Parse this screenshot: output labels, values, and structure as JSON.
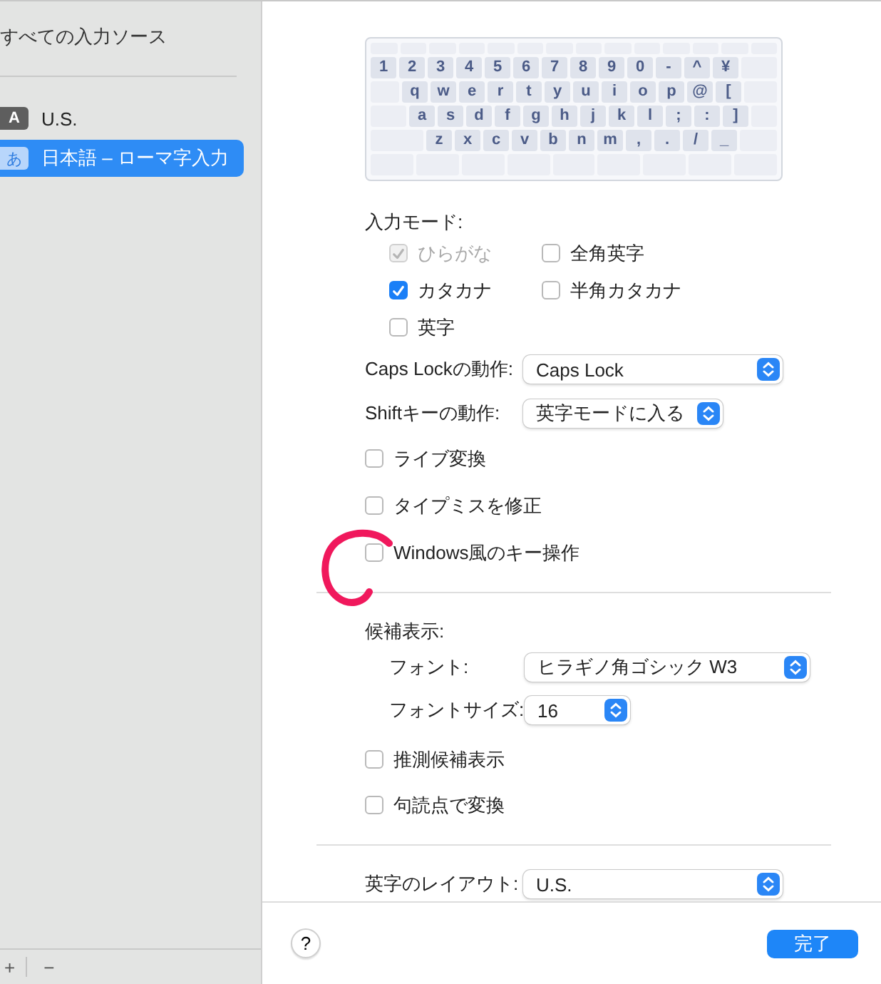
{
  "sidebar": {
    "header": "すべての入力ソース",
    "items": [
      {
        "badge": "A",
        "label": "U.S.",
        "selected": false
      },
      {
        "badge": "あ",
        "label": "日本語 – ローマ字入力",
        "selected": true
      }
    ],
    "footer_buttons": [
      "+",
      "−"
    ]
  },
  "keyboard": {
    "rows": [
      {
        "keys": [
          "1",
          "2",
          "3",
          "4",
          "5",
          "6",
          "7",
          "8",
          "9",
          "0",
          "-",
          "^",
          "¥"
        ]
      },
      {
        "keys": [
          "q",
          "w",
          "e",
          "r",
          "t",
          "y",
          "u",
          "i",
          "o",
          "p",
          "@",
          "["
        ]
      },
      {
        "keys": [
          "a",
          "s",
          "d",
          "f",
          "g",
          "h",
          "j",
          "k",
          "l",
          ";",
          ":",
          "]"
        ]
      },
      {
        "keys": [
          "z",
          "x",
          "c",
          "v",
          "b",
          "n",
          "m",
          ",",
          ".",
          "/",
          "_"
        ]
      }
    ]
  },
  "input_modes": {
    "label": "入力モード:",
    "options": [
      {
        "label": "ひらがな",
        "checked": true,
        "disabled": true
      },
      {
        "label": "全角英字",
        "checked": false,
        "disabled": false
      },
      {
        "label": "カタカナ",
        "checked": true,
        "disabled": false
      },
      {
        "label": "半角カタカナ",
        "checked": false,
        "disabled": false
      },
      {
        "label": "英字",
        "checked": false,
        "disabled": false
      }
    ]
  },
  "settings": [
    {
      "kind": "popup",
      "label": "Caps Lockの動作:",
      "value": "Caps Lock"
    },
    {
      "kind": "popup",
      "label": "Shiftキーの動作:",
      "value": "英字モードに入る"
    },
    {
      "kind": "checkbox",
      "label": "ライブ変換",
      "checked": false
    },
    {
      "kind": "checkbox",
      "label": "タイプミスを修正",
      "checked": false
    },
    {
      "kind": "checkbox",
      "label": "Windows風のキー操作",
      "checked": false
    }
  ],
  "candidates": {
    "label": "候補表示:",
    "rows": [
      {
        "kind": "popup",
        "label": "フォント:",
        "value": "ヒラギノ角ゴシック W3"
      },
      {
        "kind": "popup",
        "label": "フォントサイズ:",
        "value": "16"
      },
      {
        "kind": "checkbox",
        "label": "推測候補表示",
        "checked": false
      },
      {
        "kind": "checkbox",
        "label": "句読点で変換",
        "checked": false
      }
    ]
  },
  "layout_row": {
    "label": "英字のレイアウト:",
    "value": "U.S."
  },
  "footer": {
    "help": "?",
    "done": "完了"
  }
}
